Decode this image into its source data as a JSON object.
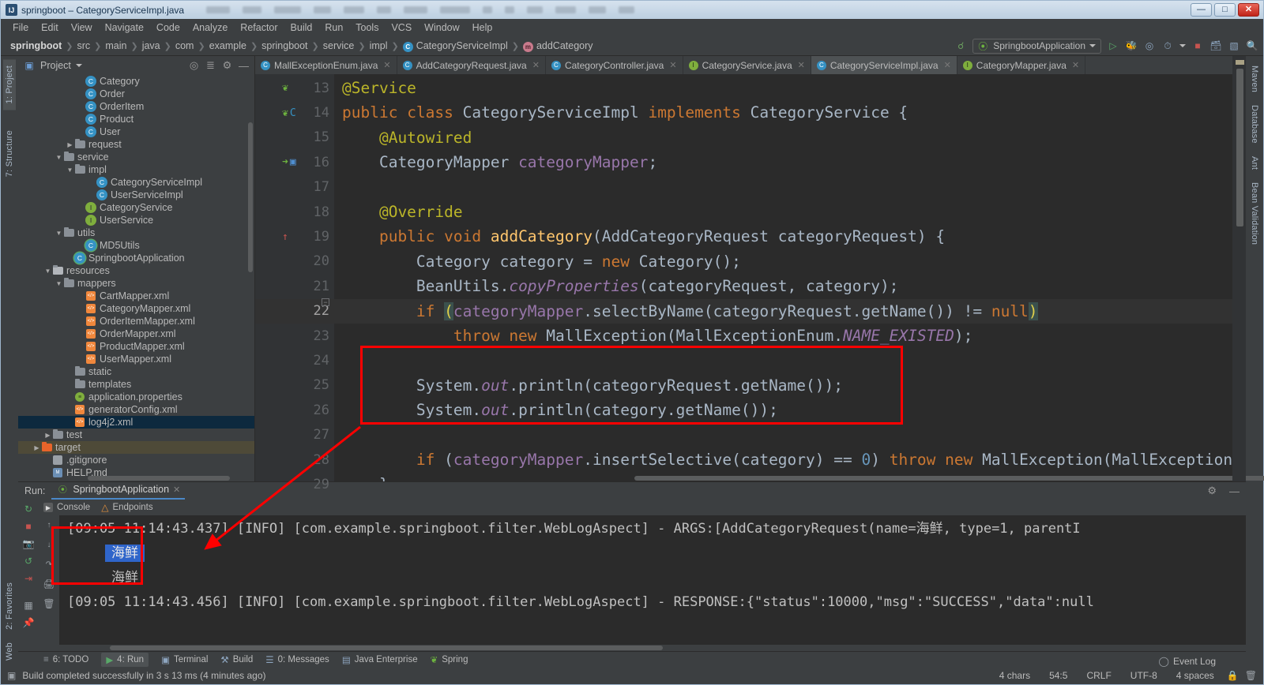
{
  "window": {
    "title": "springboot – CategoryServiceImpl.java",
    "app_icon": "intellij-idea-icon",
    "minimize_label": "—",
    "maximize_label": "□",
    "close_label": "✕"
  },
  "menu": {
    "items": [
      "File",
      "Edit",
      "View",
      "Navigate",
      "Code",
      "Analyze",
      "Refactor",
      "Build",
      "Run",
      "Tools",
      "VCS",
      "Window",
      "Help"
    ]
  },
  "navbar": {
    "breadcrumbs": [
      {
        "label": "springboot",
        "bold": true,
        "icon": null
      },
      {
        "label": "src",
        "bold": false,
        "icon": null
      },
      {
        "label": "main",
        "bold": false,
        "icon": null
      },
      {
        "label": "java",
        "bold": false,
        "icon": null
      },
      {
        "label": "com",
        "bold": false,
        "icon": null
      },
      {
        "label": "example",
        "bold": false,
        "icon": null
      },
      {
        "label": "springboot",
        "bold": false,
        "icon": null
      },
      {
        "label": "service",
        "bold": false,
        "icon": null
      },
      {
        "label": "impl",
        "bold": false,
        "icon": null
      },
      {
        "label": "CategoryServiceImpl",
        "bold": false,
        "icon": "class"
      },
      {
        "label": "addCategory",
        "bold": false,
        "icon": "method"
      }
    ],
    "run_configuration": "SpringbootApplication",
    "toolbar_icons": [
      "build-hammer-icon",
      "run-icon",
      "debug-icon",
      "run-with-coverage-icon",
      "profiler-icon",
      "stop-icon",
      "database-icon",
      "terminal-icon",
      "search-icon"
    ]
  },
  "left_strip": {
    "tabs": [
      "1: Project",
      "7: Structure"
    ]
  },
  "right_strip": {
    "tabs": [
      "Maven",
      "Database",
      "Ant",
      "Bean Validation"
    ]
  },
  "project_panel": {
    "title": "Project",
    "header_icons": [
      "locate-icon",
      "collapse-all-icon",
      "gear-icon",
      "hide-icon"
    ],
    "tree": [
      {
        "indent": 5,
        "arrow": "",
        "icon": "class",
        "label": "Category",
        "state": ""
      },
      {
        "indent": 5,
        "arrow": "",
        "icon": "class",
        "label": "Order",
        "state": ""
      },
      {
        "indent": 5,
        "arrow": "",
        "icon": "class",
        "label": "OrderItem",
        "state": ""
      },
      {
        "indent": 5,
        "arrow": "",
        "icon": "class",
        "label": "Product",
        "state": ""
      },
      {
        "indent": 5,
        "arrow": "",
        "icon": "class",
        "label": "User",
        "state": ""
      },
      {
        "indent": 4,
        "arrow": "▶",
        "icon": "folder",
        "label": "request",
        "state": ""
      },
      {
        "indent": 3,
        "arrow": "▼",
        "icon": "folder",
        "label": "service",
        "state": ""
      },
      {
        "indent": 4,
        "arrow": "▼",
        "icon": "folder",
        "label": "impl",
        "state": ""
      },
      {
        "indent": 6,
        "arrow": "",
        "icon": "class",
        "label": "CategoryServiceImpl",
        "state": ""
      },
      {
        "indent": 6,
        "arrow": "",
        "icon": "class",
        "label": "UserServiceImpl",
        "state": ""
      },
      {
        "indent": 5,
        "arrow": "",
        "icon": "interface",
        "label": "CategoryService",
        "state": ""
      },
      {
        "indent": 5,
        "arrow": "",
        "icon": "interface",
        "label": "UserService",
        "state": ""
      },
      {
        "indent": 3,
        "arrow": "▼",
        "icon": "folder",
        "label": "utils",
        "state": ""
      },
      {
        "indent": 5,
        "arrow": "",
        "icon": "class-run",
        "label": "MD5Utils",
        "state": ""
      },
      {
        "indent": 4,
        "arrow": "",
        "icon": "class-run",
        "label": "SpringbootApplication",
        "state": ""
      },
      {
        "indent": 2,
        "arrow": "▼",
        "icon": "res-folder",
        "label": "resources",
        "state": ""
      },
      {
        "indent": 3,
        "arrow": "▼",
        "icon": "folder",
        "label": "mappers",
        "state": ""
      },
      {
        "indent": 5,
        "arrow": "",
        "icon": "xml",
        "label": "CartMapper.xml",
        "state": ""
      },
      {
        "indent": 5,
        "arrow": "",
        "icon": "xml",
        "label": "CategoryMapper.xml",
        "state": ""
      },
      {
        "indent": 5,
        "arrow": "",
        "icon": "xml",
        "label": "OrderItemMapper.xml",
        "state": ""
      },
      {
        "indent": 5,
        "arrow": "",
        "icon": "xml",
        "label": "OrderMapper.xml",
        "state": ""
      },
      {
        "indent": 5,
        "arrow": "",
        "icon": "xml",
        "label": "ProductMapper.xml",
        "state": ""
      },
      {
        "indent": 5,
        "arrow": "",
        "icon": "xml",
        "label": "UserMapper.xml",
        "state": ""
      },
      {
        "indent": 4,
        "arrow": "",
        "icon": "folder",
        "label": "static",
        "state": ""
      },
      {
        "indent": 4,
        "arrow": "",
        "icon": "folder",
        "label": "templates",
        "state": ""
      },
      {
        "indent": 4,
        "arrow": "",
        "icon": "properties",
        "label": "application.properties",
        "state": ""
      },
      {
        "indent": 4,
        "arrow": "",
        "icon": "xml",
        "label": "generatorConfig.xml",
        "state": ""
      },
      {
        "indent": 4,
        "arrow": "",
        "icon": "xml",
        "label": "log4j2.xml",
        "state": "selected"
      },
      {
        "indent": 2,
        "arrow": "▶",
        "icon": "folder",
        "label": "test",
        "state": ""
      },
      {
        "indent": 1,
        "arrow": "▶",
        "icon": "target-folder",
        "label": "target",
        "state": "target"
      },
      {
        "indent": 2,
        "arrow": "",
        "icon": "git",
        "label": ".gitignore",
        "state": ""
      },
      {
        "indent": 2,
        "arrow": "",
        "icon": "md",
        "label": "HELP.md",
        "state": ""
      }
    ]
  },
  "editor": {
    "tabs": [
      {
        "label": "MallExceptionEnum.java",
        "icon": "class",
        "active": false
      },
      {
        "label": "AddCategoryRequest.java",
        "icon": "class",
        "active": false
      },
      {
        "label": "CategoryController.java",
        "icon": "class",
        "active": false
      },
      {
        "label": "CategoryService.java",
        "icon": "interface",
        "active": false
      },
      {
        "label": "CategoryServiceImpl.java",
        "icon": "class",
        "active": true
      },
      {
        "label": "CategoryMapper.java",
        "icon": "interface",
        "active": false
      }
    ],
    "lines": [
      {
        "num": "13",
        "current": false,
        "marks": [
          "spring-bean-icon"
        ],
        "tokens": [
          {
            "t": "@Service",
            "c": "ann"
          }
        ]
      },
      {
        "num": "14",
        "current": false,
        "marks": [
          "spring-bean-icon",
          "implemented-icon"
        ],
        "tokens": [
          {
            "t": "public ",
            "c": "kw"
          },
          {
            "t": "class ",
            "c": "kw"
          },
          {
            "t": "CategoryServiceImpl ",
            "c": ""
          },
          {
            "t": "implements ",
            "c": "kw"
          },
          {
            "t": "CategoryService {",
            "c": ""
          }
        ]
      },
      {
        "num": "15",
        "current": false,
        "marks": [],
        "tokens": [
          {
            "t": "    @Autowired",
            "c": "ann"
          }
        ]
      },
      {
        "num": "16",
        "current": false,
        "marks": [
          "spring-autowired-icon",
          "mybatis-icon"
        ],
        "tokens": [
          {
            "t": "    CategoryMapper ",
            "c": ""
          },
          {
            "t": "categoryMapper",
            "c": "fld"
          },
          {
            "t": ";",
            "c": ""
          }
        ]
      },
      {
        "num": "17",
        "current": false,
        "marks": [],
        "tokens": [
          {
            "t": "",
            "c": ""
          }
        ]
      },
      {
        "num": "18",
        "current": false,
        "marks": [],
        "tokens": [
          {
            "t": "    @Override",
            "c": "ann"
          }
        ]
      },
      {
        "num": "19",
        "current": false,
        "marks": [
          "override-icon"
        ],
        "tokens": [
          {
            "t": "    public ",
            "c": "kw"
          },
          {
            "t": "void ",
            "c": "kw"
          },
          {
            "t": "addCategory",
            "c": "mname"
          },
          {
            "t": "(AddCategoryRequest categoryRequest) {",
            "c": ""
          }
        ]
      },
      {
        "num": "20",
        "current": false,
        "marks": [],
        "tokens": [
          {
            "t": "        Category category = ",
            "c": ""
          },
          {
            "t": "new ",
            "c": "kw"
          },
          {
            "t": "Category();",
            "c": ""
          }
        ]
      },
      {
        "num": "21",
        "current": false,
        "marks": [],
        "tokens": [
          {
            "t": "        BeanUtils.",
            "c": ""
          },
          {
            "t": "copyProperties",
            "c": "stat"
          },
          {
            "t": "(categoryRequest, category);",
            "c": ""
          }
        ]
      },
      {
        "num": "22",
        "current": true,
        "marks": [],
        "tokens": [
          {
            "t": "        if ",
            "c": "kw"
          },
          {
            "t": "(",
            "c": "brk"
          },
          {
            "t": "categoryMapper",
            "c": "fld"
          },
          {
            "t": ".selectByName(categoryRequest.getName()) != ",
            "c": ""
          },
          {
            "t": "null",
            "c": "kw"
          },
          {
            "t": ")",
            "c": "brk"
          }
        ]
      },
      {
        "num": "23",
        "current": false,
        "marks": [],
        "tokens": [
          {
            "t": "            throw new ",
            "c": "kw"
          },
          {
            "t": "MallException(MallExceptionEnum.",
            "c": ""
          },
          {
            "t": "NAME_EXISTED",
            "c": "stat"
          },
          {
            "t": ");",
            "c": ""
          }
        ]
      },
      {
        "num": "24",
        "current": false,
        "marks": [],
        "tokens": [
          {
            "t": "",
            "c": ""
          }
        ]
      },
      {
        "num": "25",
        "current": false,
        "marks": [],
        "tokens": [
          {
            "t": "        System.",
            "c": ""
          },
          {
            "t": "out",
            "c": "stat"
          },
          {
            "t": ".println(categoryRequest.getName());",
            "c": ""
          }
        ]
      },
      {
        "num": "26",
        "current": false,
        "marks": [],
        "tokens": [
          {
            "t": "        System.",
            "c": ""
          },
          {
            "t": "out",
            "c": "stat"
          },
          {
            "t": ".println(category.getName());",
            "c": ""
          }
        ]
      },
      {
        "num": "27",
        "current": false,
        "marks": [],
        "tokens": [
          {
            "t": "",
            "c": ""
          }
        ]
      },
      {
        "num": "28",
        "current": false,
        "marks": [],
        "tokens": [
          {
            "t": "        if ",
            "c": "kw"
          },
          {
            "t": "(",
            "c": ""
          },
          {
            "t": "categoryMapper",
            "c": "fld"
          },
          {
            "t": ".insertSelective(category) == ",
            "c": ""
          },
          {
            "t": "0",
            "c": "num"
          },
          {
            "t": ") ",
            "c": ""
          },
          {
            "t": "throw new ",
            "c": "kw"
          },
          {
            "t": "MallException(MallExceptionEnu",
            "c": ""
          }
        ]
      },
      {
        "num": "29",
        "current": false,
        "marks": [],
        "tokens": [
          {
            "t": "    }",
            "c": ""
          }
        ]
      }
    ]
  },
  "run_panel": {
    "label": "Run:",
    "configuration_tab": "SpringbootApplication",
    "tool_icons": [
      "rerun-icon",
      "stop-icon",
      "screenshot-icon",
      "restart-icon",
      "export-icon",
      "layout-icon",
      "pin-icon"
    ],
    "console_tabs": [
      {
        "label": "Console",
        "icon": "console-icon",
        "active": true
      },
      {
        "label": "Endpoints",
        "icon": "endpoints-icon",
        "active": false
      }
    ],
    "side_icons": [
      "scroll-up-icon",
      "scroll-down-icon",
      "soft-wrap-icon",
      "print-icon",
      "clear-all-icon"
    ],
    "console_lines": [
      {
        "text": "[09:05 11:14:43.437] [INFO] [com.example.springboot.filter.WebLogAspect] - ARGS:[AddCategoryRequest(name=海鲜, type=1, parentI",
        "kind": "log"
      },
      {
        "text": "海鲜",
        "kind": "selected-output"
      },
      {
        "text": "海鲜",
        "kind": "output"
      },
      {
        "text": "[09:05 11:14:43.456] [INFO] [com.example.springboot.filter.WebLogAspect] - RESPONSE:{\"status\":10000,\"msg\":\"SUCCESS\",\"data\":null",
        "kind": "log"
      }
    ]
  },
  "tool_window_bar": {
    "items": [
      {
        "label": "6: TODO",
        "icon": "todo-icon",
        "active": false
      },
      {
        "label": "4: Run",
        "icon": "run-icon",
        "active": true
      },
      {
        "label": "Terminal",
        "icon": "terminal-icon",
        "active": false
      },
      {
        "label": "Build",
        "icon": "build-icon",
        "active": false
      },
      {
        "label": "0: Messages",
        "icon": "messages-icon",
        "active": false
      },
      {
        "label": "Java Enterprise",
        "icon": "java-enterprise-icon",
        "active": false
      },
      {
        "label": "Spring",
        "icon": "spring-icon",
        "active": false
      }
    ]
  },
  "status_bar": {
    "message": "Build completed successfully in 3 s 13 ms (4 minutes ago)",
    "char_count": "4 chars",
    "caret_position": "54:5",
    "line_separator": "CRLF",
    "encoding": "UTF-8",
    "indent": "4 spaces",
    "event_log": "Event Log",
    "right_icons": [
      "lock-icon",
      "trash-icon"
    ]
  },
  "favorites_tab": "2: Favorites",
  "web_tab": "Web",
  "annotation": {
    "color": "#ff0000",
    "type": "callout-arrow-and-boxes"
  }
}
